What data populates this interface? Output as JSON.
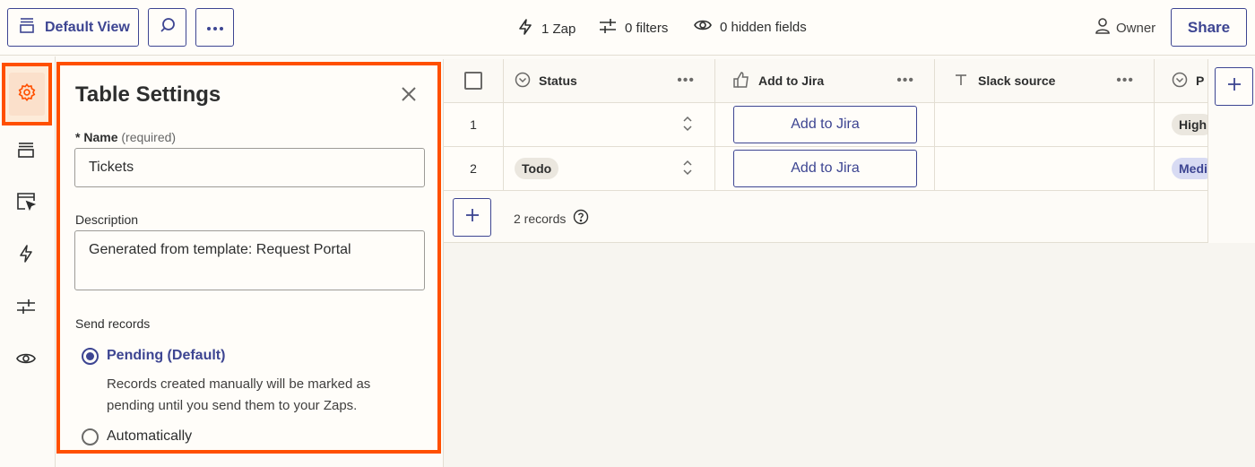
{
  "toolbar": {
    "view_label": "Default View",
    "zaps": "1 Zap",
    "filters": "0 filters",
    "hidden_fields": "0 hidden fields",
    "owner": "Owner",
    "share": "Share"
  },
  "settings": {
    "title": "Table Settings",
    "name_label": "Name",
    "name_required": "(required)",
    "name_value": "Tickets",
    "description_label": "Description",
    "description_value": "Generated from template: Request Portal",
    "send_records_label": "Send records",
    "option_pending": "Pending (Default)",
    "option_pending_help": "Records created manually will be marked as pending until you send them to your Zaps.",
    "option_auto": "Automatically"
  },
  "grid": {
    "columns": [
      "Status",
      "Add to Jira",
      "Slack source",
      "P"
    ],
    "rows": [
      {
        "num": "1",
        "status": "",
        "jira": "Add to Jira",
        "slack": "",
        "priority": "High"
      },
      {
        "num": "2",
        "status": "Todo",
        "jira": "Add to Jira",
        "slack": "",
        "priority": "Medi"
      }
    ],
    "record_count": "2 records"
  },
  "colors": {
    "accent": "#3d4592",
    "highlight": "#ff4f00"
  }
}
